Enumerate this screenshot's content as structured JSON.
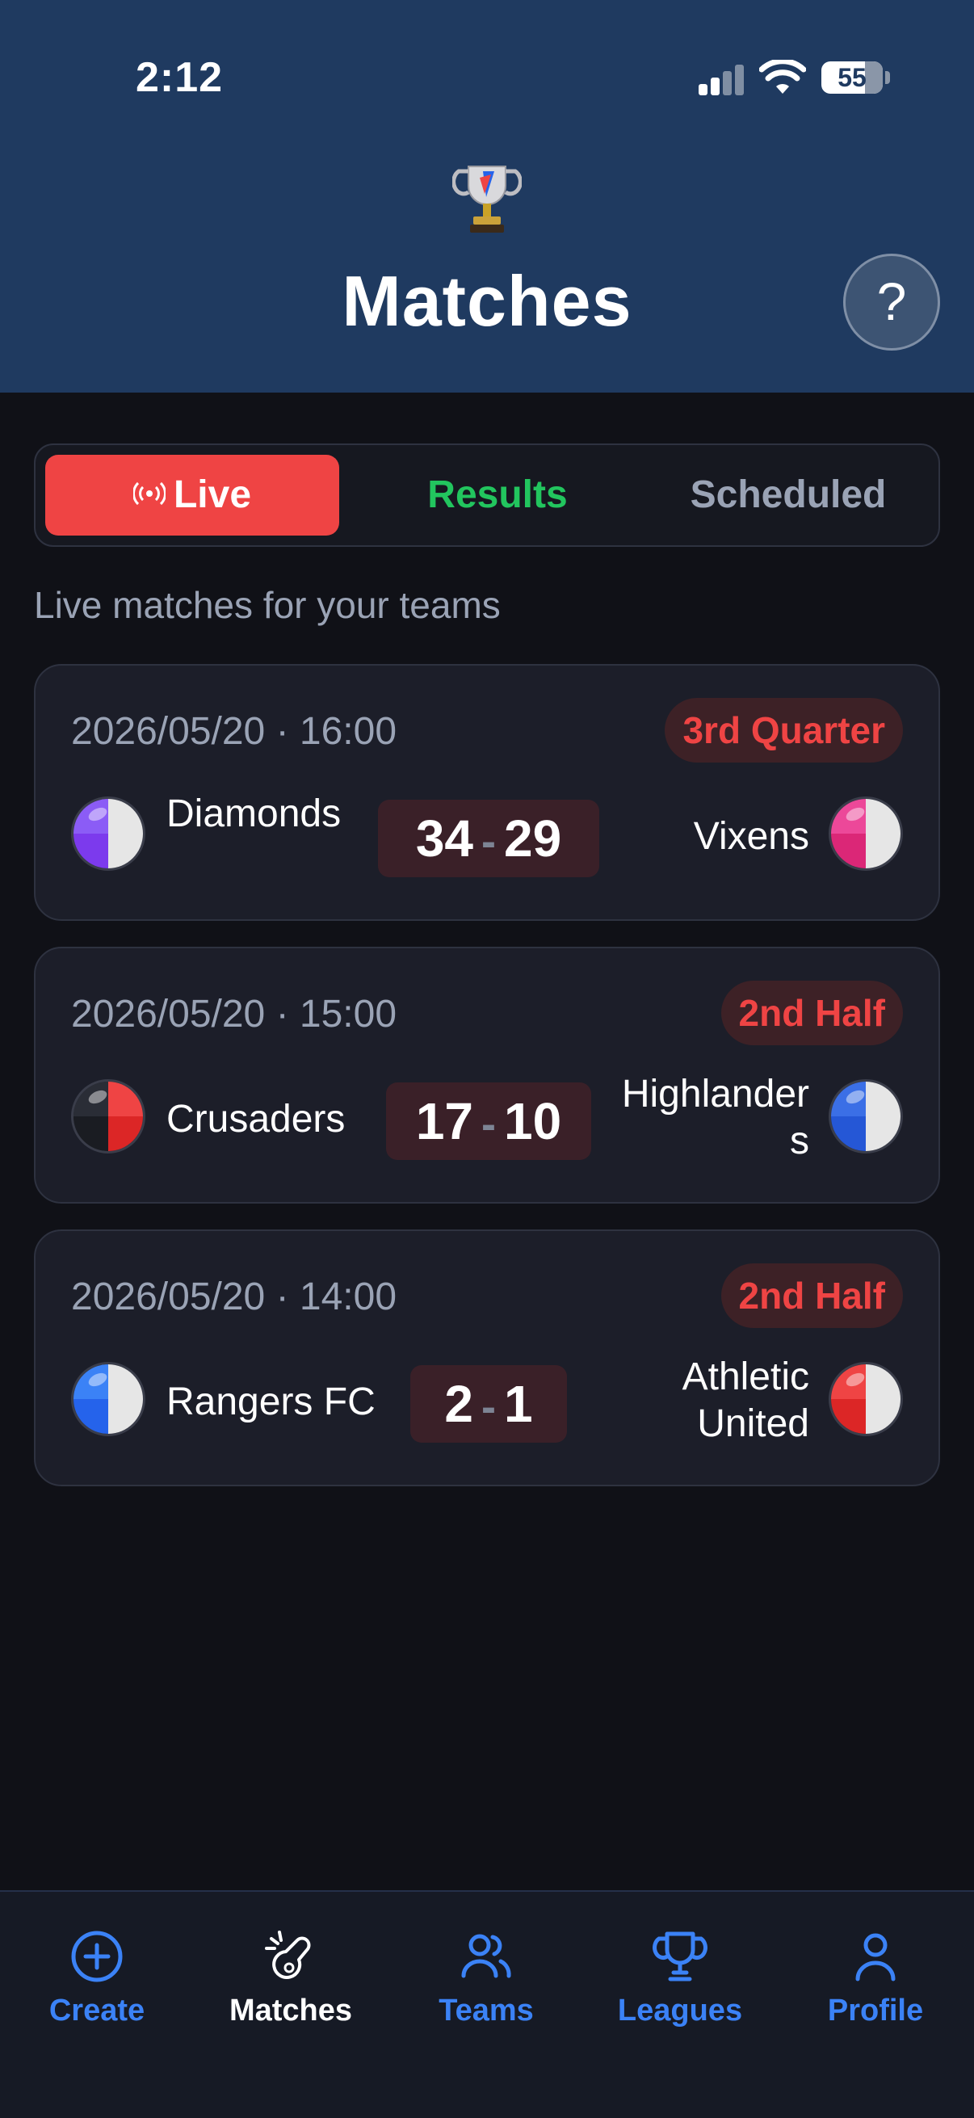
{
  "status_bar": {
    "time": "2:12",
    "battery": "55"
  },
  "header": {
    "title": "Matches",
    "help_label": "?"
  },
  "tabs": {
    "live": "Live",
    "results": "Results",
    "scheduled": "Scheduled"
  },
  "subtitle": "Live matches for your teams",
  "matches": [
    {
      "datetime": "2026/05/20 · 16:00",
      "period": "3rd Quarter",
      "home": {
        "name": "Diamonds",
        "score": "34",
        "colors": [
          "#8b5cf6",
          "#e6e6e6",
          "#7c3aed",
          "#e6e6e6"
        ]
      },
      "away": {
        "name": "Vixens",
        "score": "29",
        "colors": [
          "#ec4899",
          "#e6e6e6",
          "#db2777",
          "#e6e6e6"
        ]
      },
      "separator": "-"
    },
    {
      "datetime": "2026/05/20 · 15:00",
      "period": "2nd Half",
      "home": {
        "name": "Crusaders",
        "score": "17",
        "colors": [
          "#2a2d36",
          "#ef4444",
          "#1a1c22",
          "#dc2626"
        ]
      },
      "away": {
        "name": "Highlanders",
        "score": "10",
        "colors": [
          "#3b6fe6",
          "#e6e6e6",
          "#2557d6",
          "#e6e6e6"
        ]
      },
      "separator": "-"
    },
    {
      "datetime": "2026/05/20 · 14:00",
      "period": "2nd Half",
      "home": {
        "name": "Rangers FC",
        "score": "2",
        "colors": [
          "#3b82f6",
          "#e6e6e6",
          "#2563eb",
          "#e6e6e6"
        ]
      },
      "away": {
        "name": "Athletic United",
        "score": "1",
        "colors": [
          "#ef4444",
          "#e6e6e6",
          "#dc2626",
          "#e6e6e6"
        ]
      },
      "separator": "-"
    }
  ],
  "nav": {
    "create": "Create",
    "matches": "Matches",
    "teams": "Teams",
    "leagues": "Leagues",
    "profile": "Profile"
  },
  "colors": {
    "header_bg": "#1f3a60",
    "live_red": "#ef4444",
    "results_green": "#22c55e",
    "nav_blue": "#3b82f6"
  }
}
